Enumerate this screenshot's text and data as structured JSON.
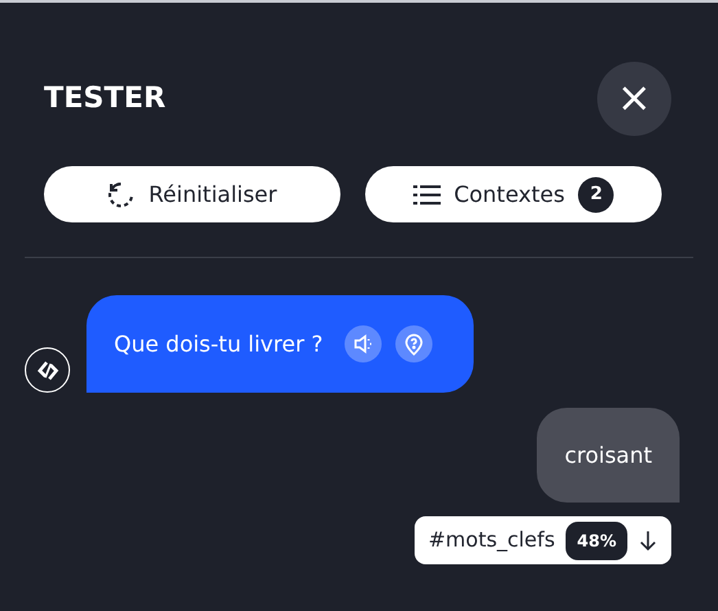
{
  "header": {
    "title": "TESTER",
    "close": "×"
  },
  "actions": [
    {
      "kind": "reset",
      "label": "Réinitialiser"
    },
    {
      "kind": "contexts",
      "label": "Contextes",
      "badge": "2"
    }
  ],
  "messages": [
    {
      "kind": "bot",
      "text": "Que dois-tu livrer ?"
    },
    {
      "kind": "user",
      "text": "croisant"
    }
  ],
  "keyword": {
    "tag": "#mots_clefs",
    "score": "48%"
  }
}
